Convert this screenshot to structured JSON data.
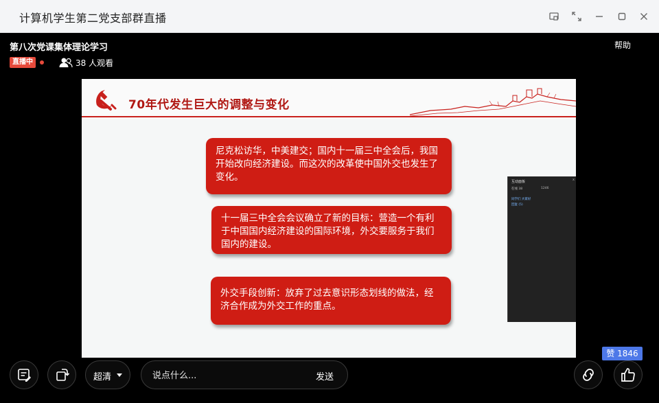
{
  "window": {
    "title": "计算机学生第二党支部群直播"
  },
  "live": {
    "title": "第八次党课集体理论学习",
    "help": "帮助",
    "badge": "直播中",
    "viewers": "38 人观看"
  },
  "slide": {
    "title": "70年代发生巨大的调整与变化",
    "boxes": [
      {
        "text": "尼克松访华，中美建交；国内十一届三中全会后，我国开始改向经济建设。而这次的改革使中国外交也发生了变化。"
      },
      {
        "text": "十一届三中全会会议确立了新的目标：营造一个有利于中国国内经济建设的国际环境，外交要服务于我们国内的建设。"
      },
      {
        "text": "外交手段创新：放弃了过去意识形态划线的做法，经济合作成为外交工作的重点。"
      }
    ],
    "panel": {
      "title": "互动面板",
      "close": "x",
      "stat_a": "在线 38",
      "stat_b": "1246",
      "row1": "同学们 大家好",
      "row2": "回复 (5)"
    }
  },
  "controls": {
    "quality": "超清",
    "chat_placeholder": "说点什么...",
    "send": "发送",
    "likes": "赞 1846"
  },
  "colors": {
    "slide_red": "#cf1d14",
    "live_badge": "#e64a3b",
    "likes_badge": "#4d78e8"
  }
}
